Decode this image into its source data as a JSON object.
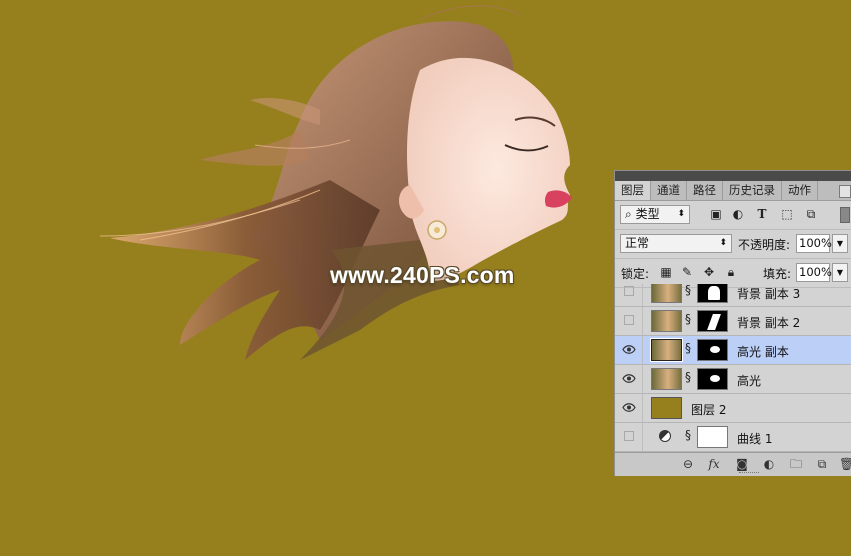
{
  "watermark": "www.240PS.com",
  "colors": {
    "canvas_bg": "#967f1d",
    "selection": "#bccff6"
  },
  "panel": {
    "tabs": [
      "图层",
      "通道",
      "路径",
      "历史记录",
      "动作"
    ],
    "active_tab": "图层",
    "filter": {
      "label": "类型",
      "icons": [
        "image-filter-icon",
        "adjustment-filter-icon",
        "type-filter-icon",
        "shape-filter-icon",
        "smart-object-filter-icon"
      ]
    },
    "blend_mode": "正常",
    "opacity_label": "不透明度:",
    "opacity_value": "100%",
    "lock_label": "锁定:",
    "fill_label": "填充:",
    "fill_value": "100%",
    "layers": [
      {
        "name": "背景 副本 3",
        "visible": false,
        "selected": false
      },
      {
        "name": "背景 副本 2",
        "visible": false,
        "selected": false
      },
      {
        "name": "高光  副本",
        "visible": true,
        "selected": true
      },
      {
        "name": "高光",
        "visible": true,
        "selected": false
      },
      {
        "name": "图层 2",
        "visible": true,
        "selected": false
      },
      {
        "name": "曲线 1",
        "visible": false,
        "selected": false
      }
    ],
    "footer_icons": [
      "link-layers-icon",
      "fx-icon",
      "add-mask-icon",
      "new-adjustment-icon",
      "new-group-icon",
      "new-layer-icon",
      "delete-layer-icon"
    ]
  }
}
